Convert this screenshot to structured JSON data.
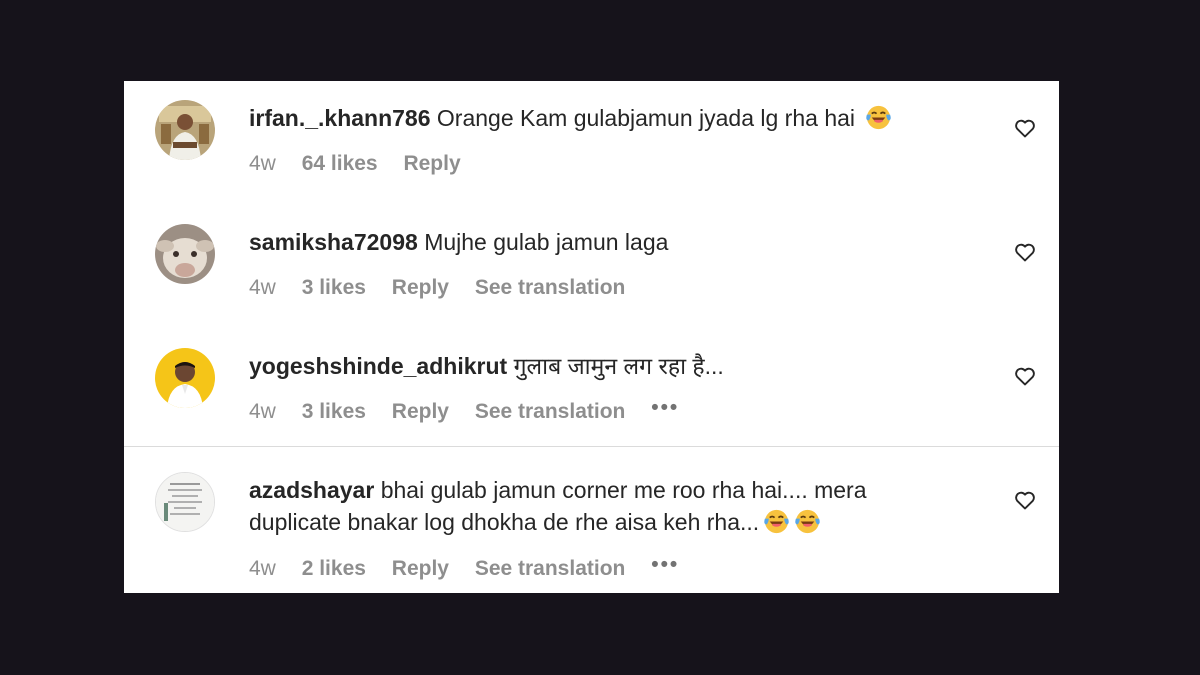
{
  "comments": [
    {
      "username": "irfan._.khann786",
      "text": "Orange Kam gulabjamun jyada lg rha hai",
      "emoji": "face-with-tears-of-joy",
      "age": "4w",
      "likes": "64 likes",
      "reply": "Reply"
    },
    {
      "username": "samiksha72098",
      "text": "Mujhe gulab jamun laga",
      "age": "4w",
      "likes": "3 likes",
      "reply": "Reply",
      "translate": "See translation"
    },
    {
      "username": "yogeshshinde_adhikrut",
      "text": "गुलाब जामुन लग रहा है...",
      "age": "4w",
      "likes": "3 likes",
      "reply": "Reply",
      "translate": "See translation",
      "more": "•••"
    },
    {
      "username": "azadshayar",
      "text_line1": "bhai gulab jamun corner me roo rha hai.... mera",
      "text_line2": "duplicate bnakar log dhokha de rhe aisa keh rha...",
      "emoji": "face-with-tears-of-joy",
      "age": "4w",
      "likes": "2 likes",
      "reply": "Reply",
      "translate": "See translation",
      "more": "•••"
    }
  ],
  "colors": {
    "background": "#16131b",
    "panel": "#ffffff",
    "text": "#262626",
    "meta": "#8e8e8e",
    "divider": "#dbdbdb",
    "avatar_ring_yellow": "#f5c518"
  },
  "icons": {
    "like": "heart-outline-icon",
    "more": "more-options-icon"
  }
}
